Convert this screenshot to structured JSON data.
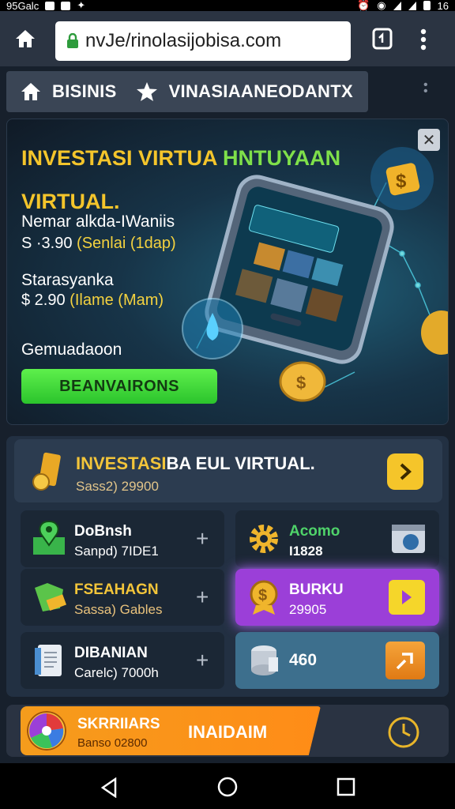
{
  "status": {
    "left_text": "95Galc",
    "time": "16"
  },
  "browser": {
    "url": "nvJe/rinolasijobisa.com"
  },
  "categories": [
    {
      "label": "BISINIS",
      "icon": "home-icon"
    },
    {
      "label": "VINASIAANEODANTX",
      "icon": "star-icon"
    }
  ],
  "hero": {
    "title_yellow": "INVESTASI VIRTUA",
    "title_green": "HNTUYAAN",
    "title_line2": "VIRTUAL.",
    "items": [
      {
        "name": "Nemar alkda-IWaniis",
        "price": "S ·3.90",
        "note": "(Senlai (1dap)"
      },
      {
        "name": "Starasyanka",
        "price": "$ 2.90",
        "note": "(Ilame (Mam)"
      }
    ],
    "footer_label": "Gemuadaoon",
    "button_label": "BEANVAIRONS",
    "close_label": "✕"
  },
  "section": {
    "title_part1": "INVESTASI",
    "title_part2": "BA EUL VIRTUAL.",
    "subtitle": "Sass2) 29900"
  },
  "tiles": [
    {
      "id": "dobnsh",
      "title": "DoBnsh",
      "sub": "Sanpd) 7IDE1",
      "icon": "map-pin-icon",
      "action": "+",
      "bg": "#1b2735"
    },
    {
      "id": "acomo",
      "title": "Acomo",
      "sub": "I1828",
      "icon": "gear-icon",
      "action": "calendar-icon",
      "bg": "#1b2735"
    },
    {
      "id": "fseahagn",
      "title": "FSEAHAGN",
      "sub": "Sassa) Gables",
      "icon": "map-icon",
      "action": "+",
      "bg": "#1b2735"
    },
    {
      "id": "burku",
      "title": "BURKU",
      "sub": "29905",
      "icon": "medal-icon",
      "action": "arrow-icon",
      "bg": "#9b3fd8"
    },
    {
      "id": "dibanian",
      "title": "DIBANIAN",
      "sub": "Carelc) 7000h",
      "icon": "document-icon",
      "action": "+",
      "bg": "#1b2735"
    },
    {
      "id": "count",
      "title": "",
      "sub": "460",
      "icon": "coin-stack-icon",
      "action": "send-icon",
      "bg": "#3d6f8d"
    }
  ],
  "bottom": {
    "name": "SKRRIIARS",
    "amount": "Banso 02800",
    "label": "INAIDAIM"
  },
  "colors": {
    "accent_yellow": "#f4c52b",
    "accent_green": "#3ed43a",
    "purple": "#9b3fd8",
    "orange": "#f59c1c"
  }
}
